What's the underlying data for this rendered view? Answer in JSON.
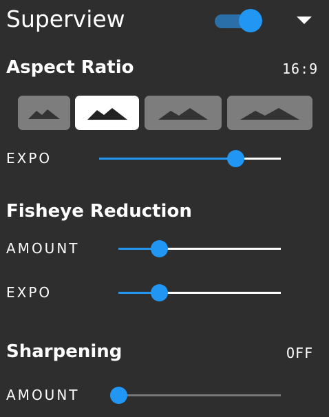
{
  "header": {
    "title": "Superview",
    "toggle_on": true
  },
  "aspect_ratio": {
    "title": "Aspect Ratio",
    "value": "16:9",
    "options": [
      {
        "icon": "mountain-icon",
        "active": false
      },
      {
        "icon": "mountain-icon",
        "active": true
      },
      {
        "icon": "mountain-icon",
        "active": false
      },
      {
        "icon": "mountain-icon",
        "active": false
      }
    ],
    "expo": {
      "label": "EXPO",
      "level": 0.75
    }
  },
  "fisheye": {
    "title": "Fisheye Reduction",
    "amount": {
      "label": "AMOUNT",
      "level": 0.25
    },
    "expo": {
      "label": "EXPO",
      "level": 0.25
    }
  },
  "sharpening": {
    "title": "Sharpening",
    "value": "OFF",
    "amount": {
      "label": "AMOUNT",
      "level": 0.0
    }
  },
  "colors": {
    "accent": "#2196f3",
    "background": "#2e2e2e",
    "button": "#7d7d7d"
  }
}
